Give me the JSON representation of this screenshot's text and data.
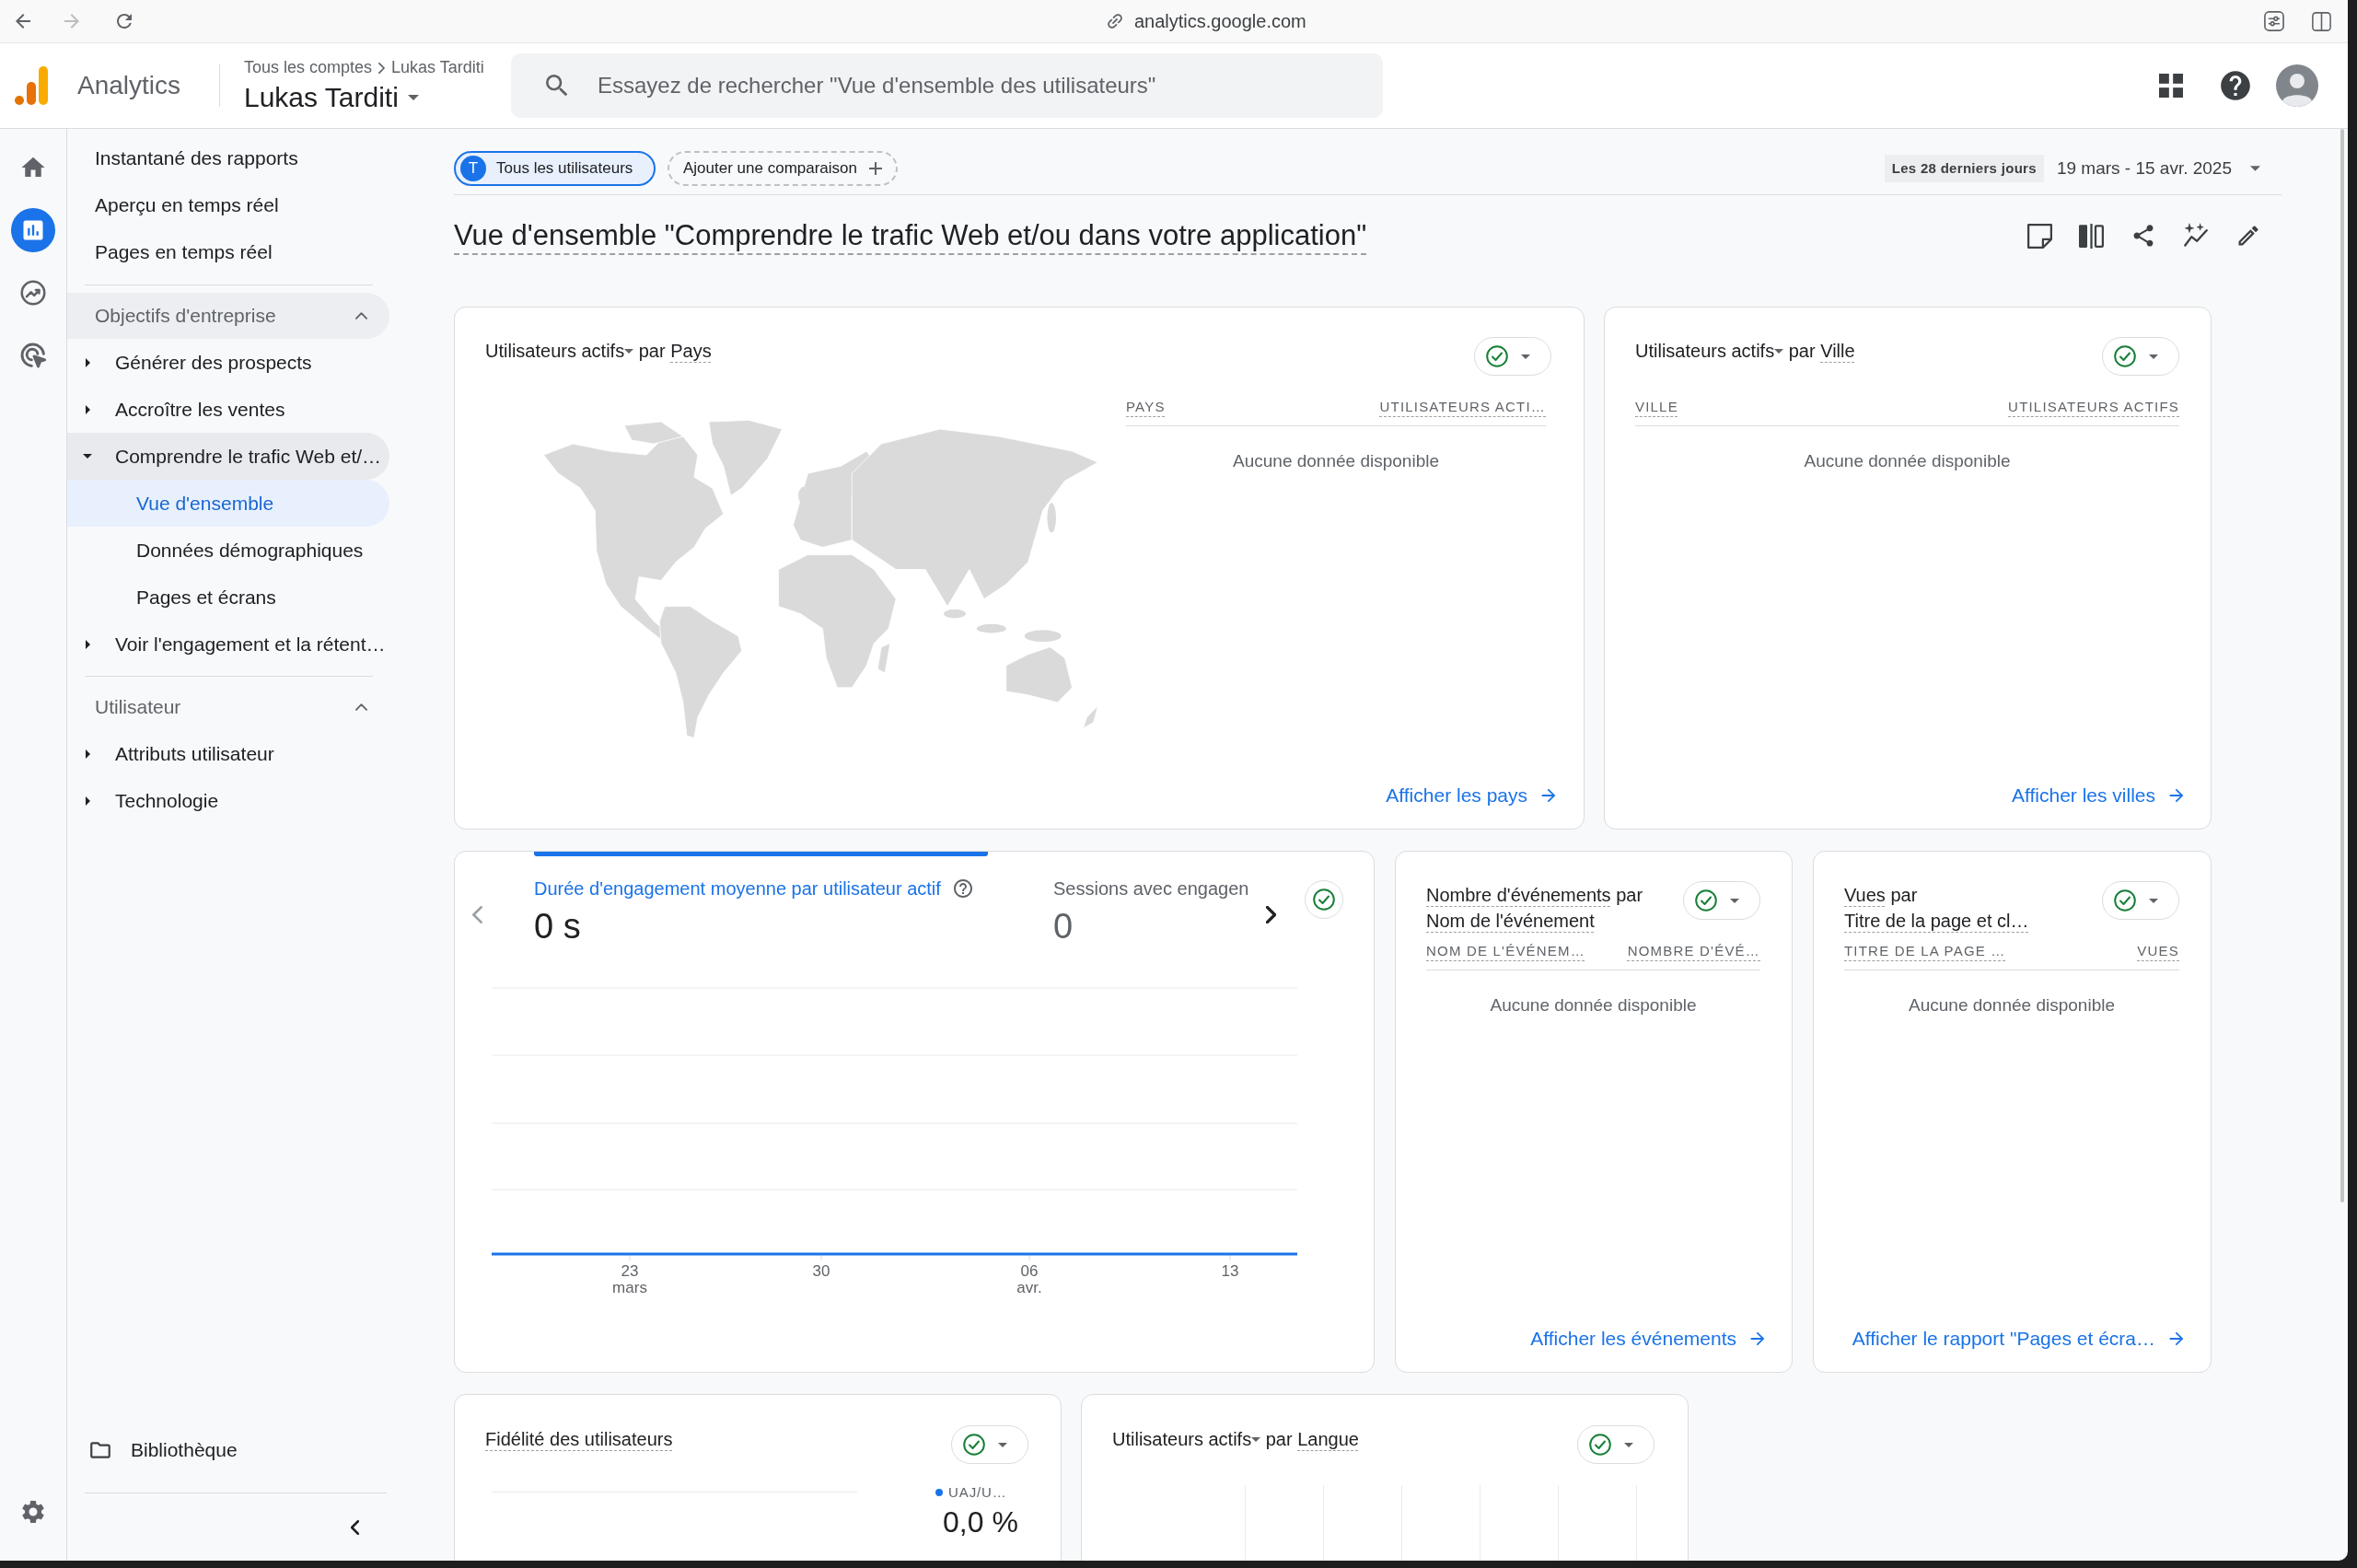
{
  "browser": {
    "url": "analytics.google.com"
  },
  "header": {
    "product": "Analytics",
    "breadcrumb": [
      "Tous les comptes",
      "Lukas Tarditi"
    ],
    "account": "Lukas Tarditi",
    "search": {
      "placeholder": "Essayez de rechercher \"Vue d'ensemble des utilisateurs\""
    }
  },
  "rail": [
    {
      "kind": "home",
      "selected": false
    },
    {
      "kind": "reports",
      "selected": true
    },
    {
      "kind": "explore",
      "selected": false
    },
    {
      "kind": "advertising",
      "selected": false
    }
  ],
  "sidebar": {
    "top_items": [
      {
        "label": "Instantané des rapports",
        "selected": false
      },
      {
        "label": "Aperçu en temps réel",
        "selected": false
      },
      {
        "label": "Pages en temps réel",
        "selected": false
      }
    ],
    "sections": [
      {
        "title": "Objectifs d'entreprise",
        "expanded": true,
        "highlighted": true,
        "items": [
          {
            "label": "Générer des prospects",
            "expanded": false,
            "highlighted": false
          },
          {
            "label": "Accroître les ventes",
            "expanded": false,
            "highlighted": false
          },
          {
            "label": "Comprendre le trafic Web et/…",
            "expanded": true,
            "highlighted": true,
            "children": [
              {
                "label": "Vue d'ensemble",
                "selected": true
              },
              {
                "label": "Données démographiques",
                "selected": false
              },
              {
                "label": "Pages et écrans",
                "selected": false
              }
            ]
          },
          {
            "label": "Voir l'engagement et la rétent…",
            "expanded": false,
            "highlighted": false
          }
        ]
      },
      {
        "title": "Utilisateur",
        "expanded": true,
        "highlighted": false,
        "items": [
          {
            "label": "Attributs utilisateur",
            "expanded": false,
            "highlighted": false
          },
          {
            "label": "Technologie",
            "expanded": false,
            "highlighted": false
          }
        ]
      }
    ],
    "library": "Bibliothèque"
  },
  "comparisons": [
    {
      "kind": "segment",
      "initial": "T",
      "label": "Tous les utilisateurs"
    },
    {
      "kind": "add",
      "label": "Ajouter une comparaison"
    }
  ],
  "date_range": {
    "preset": "Les 28 derniers jours",
    "range": "19 mars - 15 avr. 2025"
  },
  "title": "Vue d'ensemble \"Comprendre le trafic Web et/ou dans votre application\"",
  "card_rows": [
    [
      {
        "kind": "map_table",
        "metric": "Utilisateurs actifs",
        "metric_menu": true,
        "connector": "par",
        "dimension": "Pays",
        "columns": [
          "PAYS",
          "UTILISATEURS ACTI…"
        ],
        "empty": "Aucune donnée disponible",
        "link": "Afficher les pays"
      },
      {
        "kind": "table",
        "metric": "Utilisateurs actifs",
        "metric_menu": true,
        "connector": "par",
        "dimension": "Ville",
        "columns": [
          "VILLE",
          "UTILISATEURS ACTIFS"
        ],
        "empty": "Aucune donnée disponible",
        "link": "Afficher les villes"
      }
    ],
    [
      {
        "kind": "metric_chart",
        "prev_enabled": false,
        "next_enabled": true,
        "metrics": [
          {
            "label": "Durée d'engagement moyenne par utilisateur actif",
            "value": "0 s",
            "selected": true,
            "help": true
          },
          {
            "label": "Sessions avec engagen",
            "value": "0",
            "selected": false,
            "help": false
          }
        ],
        "x_labels": [
          {
            "day": "23",
            "month": "mars"
          },
          {
            "day": "30"
          },
          {
            "day": "06",
            "month": "avr."
          },
          {
            "day": "13"
          }
        ]
      },
      {
        "kind": "table",
        "metric": "Nombre d'événements",
        "metric_menu": false,
        "connector": "par",
        "dimension": "Nom de l'événement",
        "columns": [
          "NOM DE L'ÉVÉNEM…",
          "NOMBRE D'ÉVÉ…"
        ],
        "empty": "Aucune donnée disponible",
        "link": "Afficher les événements"
      },
      {
        "kind": "table",
        "metric": "Vues",
        "metric_menu": false,
        "connector": "par",
        "dimension": "Titre de la page et cl…",
        "columns": [
          "TITRE DE LA PAGE …",
          "VUES"
        ],
        "empty": "Aucune donnée disponible",
        "link": "Afficher le rapport \"Pages et écra…"
      }
    ],
    [
      {
        "kind": "retention",
        "title": "Fidélité des utilisateurs",
        "legend": "UAJ/U…",
        "value": "0,0 %"
      },
      {
        "kind": "bars",
        "metric": "Utilisateurs actifs",
        "metric_menu": true,
        "connector": "par",
        "dimension": "Langue"
      }
    ]
  ]
}
